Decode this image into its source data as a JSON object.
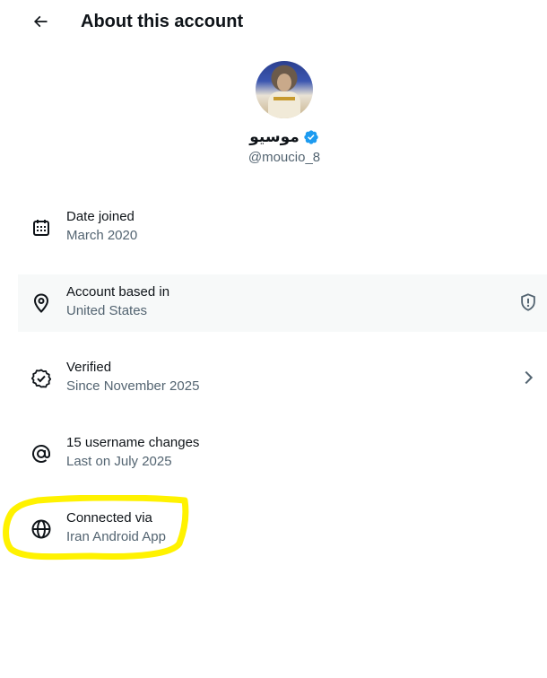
{
  "header": {
    "title": "About this account",
    "back_icon": "arrow-left-icon"
  },
  "profile": {
    "name": "موسیو",
    "handle": "@moucio_8",
    "verified_icon": "verified-badge-icon",
    "badge_color": "#1d9bf0"
  },
  "rows": [
    {
      "label": "Date joined",
      "value": "March 2020",
      "icon": "calendar-icon"
    },
    {
      "label": "Account based in",
      "value": "United States",
      "icon": "location-pin-icon",
      "right_icon": "shield-info-icon"
    },
    {
      "label": "Verified",
      "value": "Since November 2025",
      "icon": "verified-check-icon",
      "right_icon": "chevron-right-icon"
    },
    {
      "label": "15 username changes",
      "value": "Last on July 2025",
      "icon": "at-sign-icon"
    },
    {
      "label": "Connected via",
      "value": "Iran Android App",
      "icon": "globe-icon"
    }
  ],
  "colors": {
    "text": "#0f1419",
    "secondary": "#536471",
    "highlight_row": "#f7f9f9",
    "marker": "#fff200"
  }
}
